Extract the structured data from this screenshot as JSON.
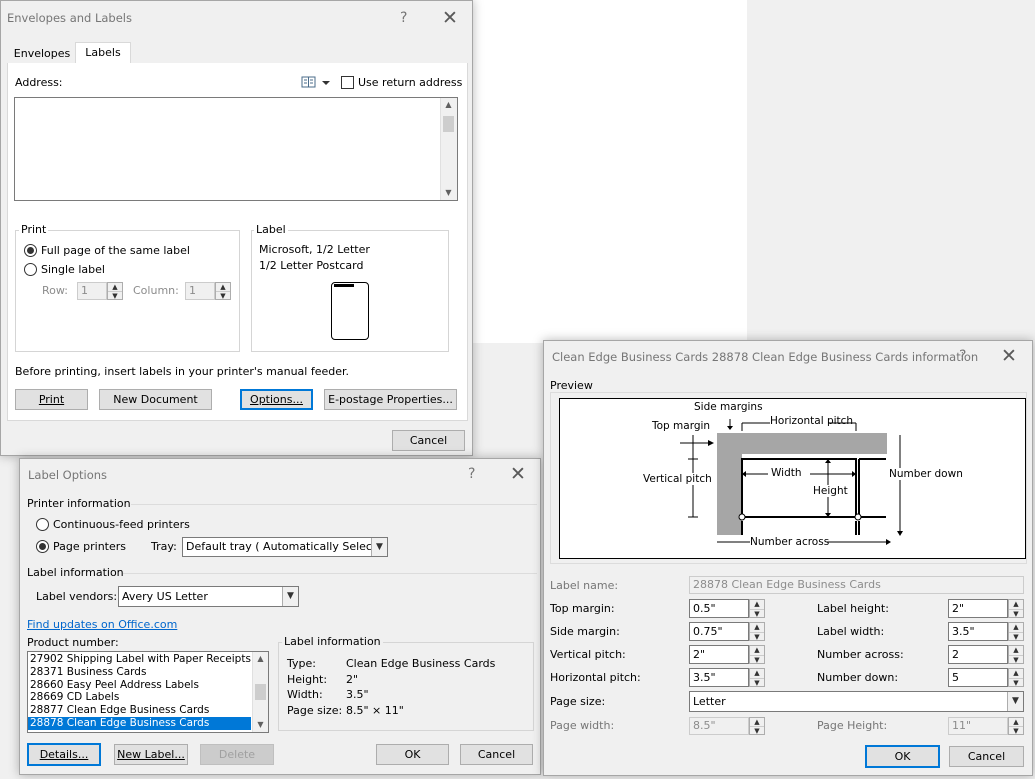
{
  "envelopes": {
    "title": "Envelopes and Labels",
    "help": "?",
    "close": "✕",
    "tabs": [
      "Envelopes",
      "Labels"
    ],
    "address_label": "Address:",
    "use_return_address": "Use return address",
    "print_group": "Print",
    "full_page": "Full page of the same label",
    "single_label": "Single label",
    "row_label": "Row:",
    "row_value": "1",
    "column_label": "Column:",
    "column_value": "1",
    "label_group": "Label",
    "label_line1": "Microsoft, 1/2 Letter",
    "label_line2": "1/2 Letter Postcard",
    "feeder_note": "Before printing, insert labels in your printer's manual feeder.",
    "buttons": {
      "print": "Print",
      "new_document": "New Document",
      "options": "Options...",
      "epostage": "E-postage Properties...",
      "cancel": "Cancel"
    }
  },
  "label_options": {
    "title": "Label Options",
    "help": "?",
    "close": "✕",
    "printer_info": "Printer information",
    "continuous": "Continuous-feed printers",
    "page_printers": "Page printers",
    "tray_label": "Tray:",
    "tray_value": "Default tray ( Automatically Select)",
    "label_info": "Label information",
    "vendors_label": "Label vendors:",
    "vendors_value": "Avery US Letter",
    "find_updates": "Find updates on Office.com",
    "product_number": "Product number:",
    "products": [
      "27902 Shipping Label with Paper Receipts",
      "28371 Business Cards",
      "28660 Easy Peel Address Labels",
      "28669 CD Labels",
      "28877 Clean Edge Business Cards",
      "28878 Clean Edge Business Cards"
    ],
    "selected_product_index": 5,
    "info_group": "Label information",
    "info": [
      {
        "key": "Type:",
        "value": "Clean Edge Business Cards"
      },
      {
        "key": "Height:",
        "value": "2\""
      },
      {
        "key": "Width:",
        "value": "3.5\""
      },
      {
        "key": "Page size:",
        "value": "8.5\" × 11\""
      }
    ],
    "buttons": {
      "details": "Details...",
      "new_label": "New Label...",
      "delete": "Delete",
      "ok": "OK",
      "cancel": "Cancel"
    }
  },
  "details": {
    "title": "Clean Edge Business Cards 28878 Clean Edge Business Cards information",
    "help": "?",
    "close": "✕",
    "preview": "Preview",
    "diagram": {
      "side_margins": "Side margins",
      "top_margin": "Top margin",
      "horizontal_pitch": "Horizontal pitch",
      "vertical_pitch": "Vertical pitch",
      "width": "Width",
      "height": "Height",
      "number_down": "Number down",
      "number_across": "Number across"
    },
    "label_name_label": "Label name:",
    "label_name_value": "28878 Clean Edge Business Cards",
    "fields_left": [
      {
        "label": "Top margin:",
        "value": "0.5\""
      },
      {
        "label": "Side margin:",
        "value": "0.75\""
      },
      {
        "label": "Vertical pitch:",
        "value": "2\""
      },
      {
        "label": "Horizontal pitch:",
        "value": "3.5\""
      }
    ],
    "fields_right": [
      {
        "label": "Label height:",
        "value": "2\""
      },
      {
        "label": "Label width:",
        "value": "3.5\""
      },
      {
        "label": "Number across:",
        "value": "2"
      },
      {
        "label": "Number down:",
        "value": "5"
      }
    ],
    "page_size_label": "Page size:",
    "page_size_value": "Letter",
    "page_width_label": "Page width:",
    "page_width_value": "8.5\"",
    "page_height_label": "Page Height:",
    "page_height_value": "11\"",
    "buttons": {
      "ok": "OK",
      "cancel": "Cancel"
    }
  }
}
